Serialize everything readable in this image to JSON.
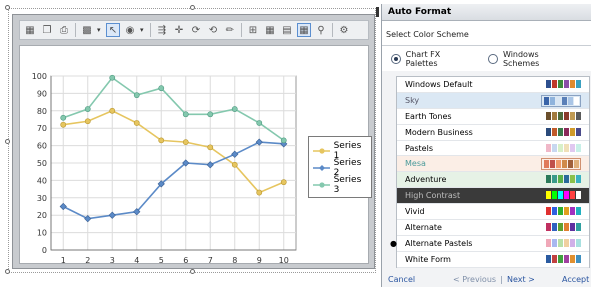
{
  "toolbar": {
    "tools": [
      "chart-gallery-icon",
      "copy-icon",
      "print-icon",
      "chart-type-icon",
      "select-icon",
      "palette-icon",
      "data-icon",
      "zoom-icon",
      "rotate-icon",
      "perspective-icon",
      "point-labels-icon",
      "axes-icon",
      "grid-icon",
      "legend-icon",
      "data-editor-icon",
      "properties-icon"
    ]
  },
  "chart_data": {
    "type": "line",
    "x": [
      1,
      2,
      3,
      4,
      5,
      6,
      7,
      8,
      9,
      10
    ],
    "xlim": [
      0.5,
      10.5
    ],
    "ylim": [
      0,
      100
    ],
    "yticks": [
      0,
      10,
      20,
      30,
      40,
      50,
      60,
      70,
      80,
      90,
      100
    ],
    "xticks": [
      "1",
      "2",
      "3",
      "4",
      "5",
      "6",
      "7",
      "8",
      "9",
      "10"
    ],
    "grid": true,
    "legend_position": "right",
    "series": [
      {
        "name": "Series 1",
        "color": "#e6c55f",
        "values": [
          72,
          74,
          80,
          73,
          63,
          62,
          59,
          49,
          33,
          39
        ]
      },
      {
        "name": "Series 2",
        "color": "#5b8ac7",
        "values": [
          25,
          18,
          20,
          22,
          38,
          50,
          49,
          55,
          62,
          61
        ]
      },
      {
        "name": "Series 3",
        "color": "#84c8ae",
        "values": [
          76,
          81,
          99,
          89,
          93,
          78,
          78,
          81,
          73,
          63
        ]
      }
    ]
  },
  "panel": {
    "title": "Auto Format",
    "subtitle": "Select Color Scheme",
    "radio_chart_fx": "Chart FX Palettes",
    "radio_windows": "Windows Schemes",
    "schemes": [
      {
        "label": "Windows Default",
        "colors": [
          "#2d4f8e",
          "#c0392b",
          "#3d8b3d",
          "#8a4fa8",
          "#e08a2e",
          "#3aa0c0"
        ]
      },
      {
        "label": "Sky",
        "colors": [
          "#3a64a8",
          "#8fb3dc",
          "#d9e6f3",
          "#5a80b8",
          "#a9c5e6",
          "#ffffff"
        ]
      },
      {
        "label": "Earth Tones",
        "colors": [
          "#6b4f2c",
          "#a27a3e",
          "#4e6b3a",
          "#8a3a2a",
          "#c09a52",
          "#5a5a5a"
        ]
      },
      {
        "label": "Modern Business",
        "colors": [
          "#2a4a7a",
          "#c05a2a",
          "#3a7a4a",
          "#8a2a5a",
          "#d09a2a",
          "#4a4a8a"
        ]
      },
      {
        "label": "Pastels",
        "colors": [
          "#f0b8c8",
          "#c8d8f0",
          "#d8f0c8",
          "#f0e0b8",
          "#e0c8f0",
          "#c8f0e8"
        ]
      },
      {
        "label": "Mesa",
        "colors": [
          "#e07a5a",
          "#c0504a",
          "#f09a6a",
          "#d08a4a",
          "#a0603a",
          "#e0b07a"
        ]
      },
      {
        "label": "Adventure",
        "colors": [
          "#2a7a5a",
          "#3a9a8a",
          "#5ab04a",
          "#2a6a9a",
          "#8ac04a",
          "#3ab0c0"
        ]
      },
      {
        "label": "High Contrast",
        "colors": [
          "#ffff00",
          "#00ff00",
          "#00ffff",
          "#ff00ff",
          "#ff4040",
          "#ffffff"
        ]
      },
      {
        "label": "Vivid",
        "colors": [
          "#e03030",
          "#3060e0",
          "#30b030",
          "#e0a020",
          "#a030c0",
          "#20b0c0"
        ]
      },
      {
        "label": "Alternate",
        "colors": [
          "#c03060",
          "#3060c0",
          "#60a030",
          "#e08030",
          "#6030a0",
          "#30a0a0"
        ]
      },
      {
        "label": "Alternate Pastels",
        "colors": [
          "#f0a8b8",
          "#a8b8f0",
          "#b8e0a8",
          "#f0d0a0",
          "#d0b0e8",
          "#a8e0e0"
        ]
      },
      {
        "label": "White Form",
        "colors": [
          "#2a5aa0",
          "#c04040",
          "#40a040",
          "#a040a0",
          "#e09030",
          "#4090c0"
        ]
      }
    ],
    "footer": {
      "cancel": "Cancel",
      "previous": "< Previous",
      "separator": "|",
      "next": "Next >",
      "accept": "Accept"
    }
  }
}
